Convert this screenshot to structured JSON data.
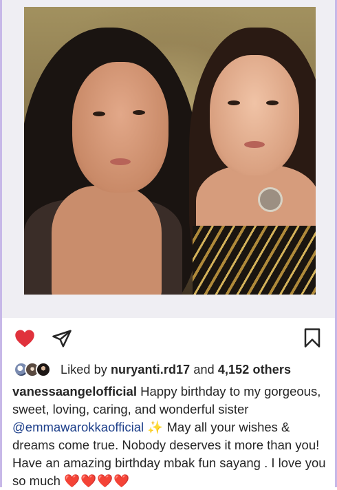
{
  "post": {
    "image_alt": "Two women posing together",
    "actions": {
      "like_icon": "heart-filled-icon",
      "like_color": "#e0323c",
      "share_icon": "paper-plane-icon",
      "save_icon": "bookmark-icon"
    },
    "likes": {
      "prefix": "Liked by ",
      "user": "nuryanti.rd17",
      "connector": " and ",
      "count_text": "4,152 others"
    },
    "caption": {
      "username": "vanessaangelofficial",
      "text_1": " Happy birthday to my gorgeous, sweet, loving, caring, and wonderful sister ",
      "mention": "@emmawarokkaofficial",
      "sparkles": " ✨",
      "text_2": " May all your wishes & dreams come true. Nobody deserves it more than you! Have an amazing birthday mbak fun sayang . I love you so much ",
      "hearts": "❤️❤️❤️❤️"
    }
  }
}
